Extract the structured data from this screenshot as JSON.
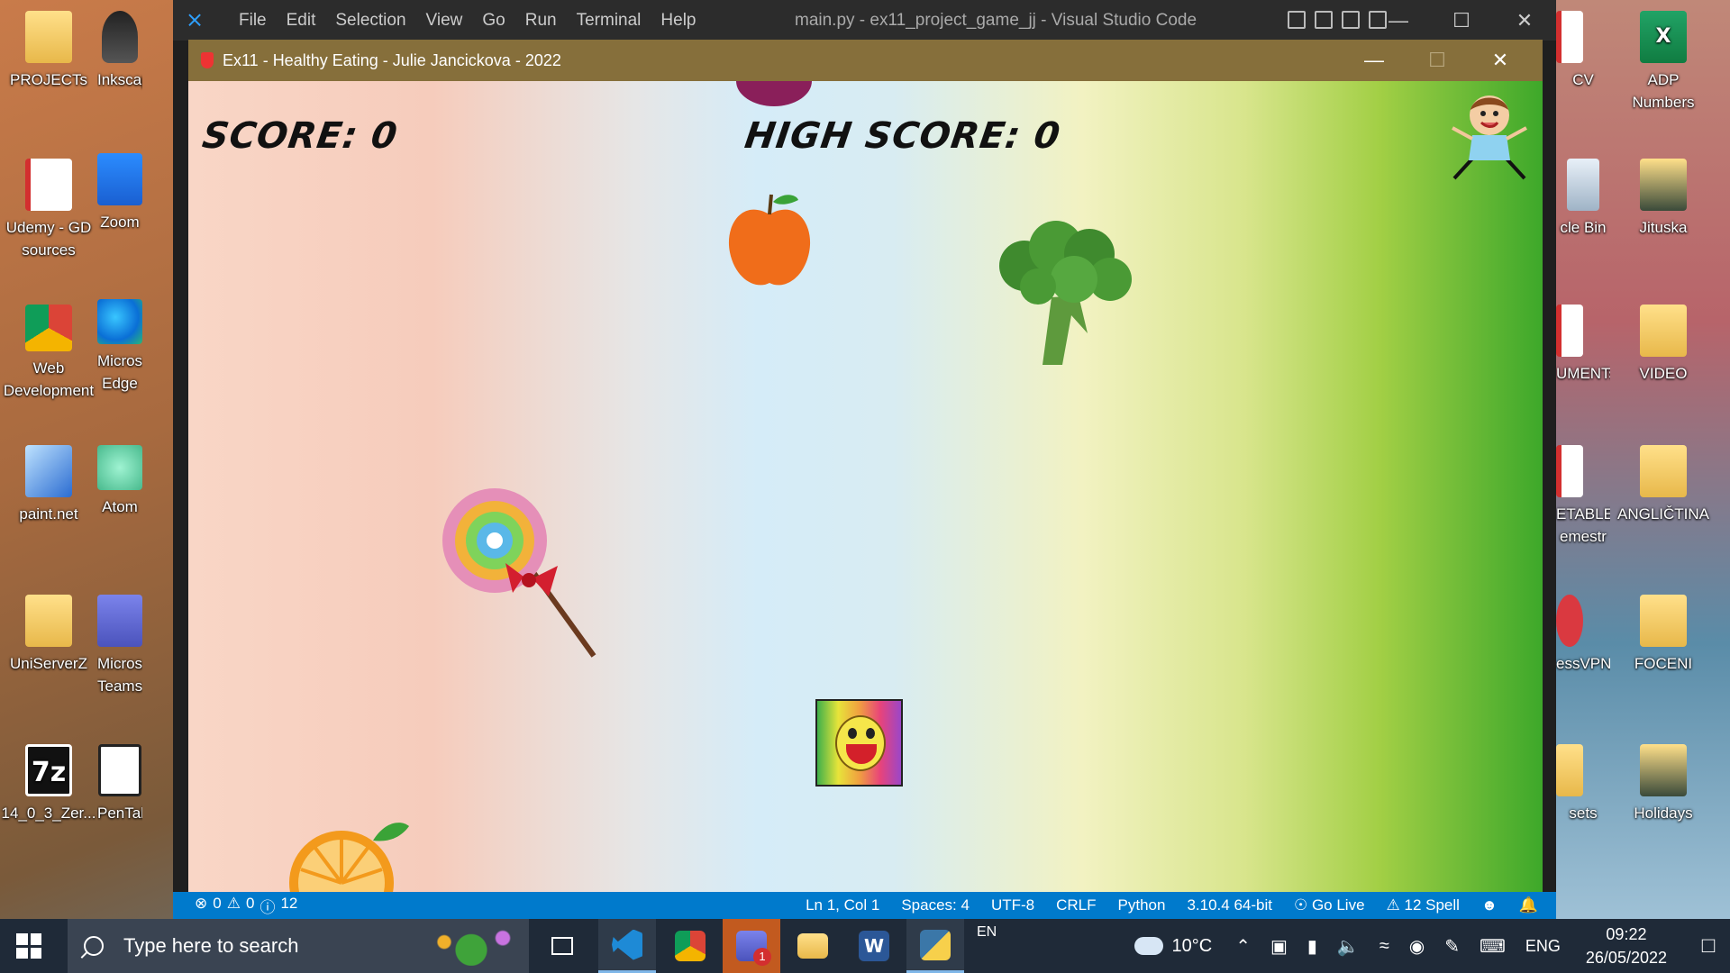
{
  "desktop": {
    "left_icons": [
      {
        "label": "PROJECTs",
        "icon": "folder-icon"
      },
      {
        "label": "Inkscap",
        "icon": "inkscape-icon"
      },
      {
        "label": "Udemy - GD sources",
        "icon": "pdf-folder-icon"
      },
      {
        "label": "Zoom",
        "icon": "zoom-icon"
      },
      {
        "label": "Web Development",
        "icon": "chrome-icon"
      },
      {
        "label": "Microso Edge",
        "icon": "edge-icon"
      },
      {
        "label": "paint.net",
        "icon": "paint-icon"
      },
      {
        "label": "Atom",
        "icon": "atom-icon"
      },
      {
        "label": "UniServerZ",
        "icon": "folder-icon"
      },
      {
        "label": "Microso Teams",
        "icon": "teams-icon"
      },
      {
        "label": "14_0_3_Zer...",
        "icon": "7zip-icon"
      },
      {
        "label": "PenTabletI",
        "icon": "pentablet-icon"
      }
    ],
    "right_icons": [
      {
        "label": "CV",
        "icon": "pdf-icon"
      },
      {
        "label": "ADP Numbers",
        "icon": "excel-icon"
      },
      {
        "label": "cle Bin",
        "icon": "recycle-bin-icon"
      },
      {
        "label": "Jituska",
        "icon": "photo-folder-icon"
      },
      {
        "label": "UMENTs",
        "icon": "pdf-icon"
      },
      {
        "label": "VIDEO",
        "icon": "folder-icon"
      },
      {
        "label": "ETABLE emestr",
        "icon": "pdf-icon"
      },
      {
        "label": "ANGLIČTINA",
        "icon": "folder-icon"
      },
      {
        "label": "essVPN",
        "icon": "vpn-icon"
      },
      {
        "label": "FOCENI",
        "icon": "folder-icon"
      },
      {
        "label": "sets",
        "icon": "folder-icon"
      },
      {
        "label": "Holidays",
        "icon": "photo-folder-icon"
      }
    ]
  },
  "vscode": {
    "menu": [
      "File",
      "Edit",
      "Selection",
      "View",
      "Go",
      "Run",
      "Terminal",
      "Help"
    ],
    "title": "main.py - ex11_project_game_jj - Visual Studio Code",
    "status": {
      "errors": "0",
      "warnings": "0",
      "info": "12",
      "cursor": "Ln 1, Col 1",
      "spaces": "Spaces: 4",
      "encoding": "UTF-8",
      "eol": "CRLF",
      "language": "Python",
      "interpreter": "3.10.4 64-bit",
      "golive": "Go Live",
      "spell": "12 Spell"
    }
  },
  "game": {
    "title": "Ex11 - Healthy Eating - Julie Jancickova - 2022",
    "score_text": "SCORE: 0",
    "highscore_text": "HIGH SCORE: 0",
    "colors": {
      "titlebar": "#866f3b",
      "left": "#f9d6c6",
      "right": "#3da82a"
    }
  },
  "taskbar": {
    "search_placeholder": "Type here to search",
    "language_indicator": "EN",
    "weather": "10°C",
    "keyboard": "ENG",
    "time": "09:22",
    "date": "26/05/2022",
    "teams_badge": "1"
  }
}
